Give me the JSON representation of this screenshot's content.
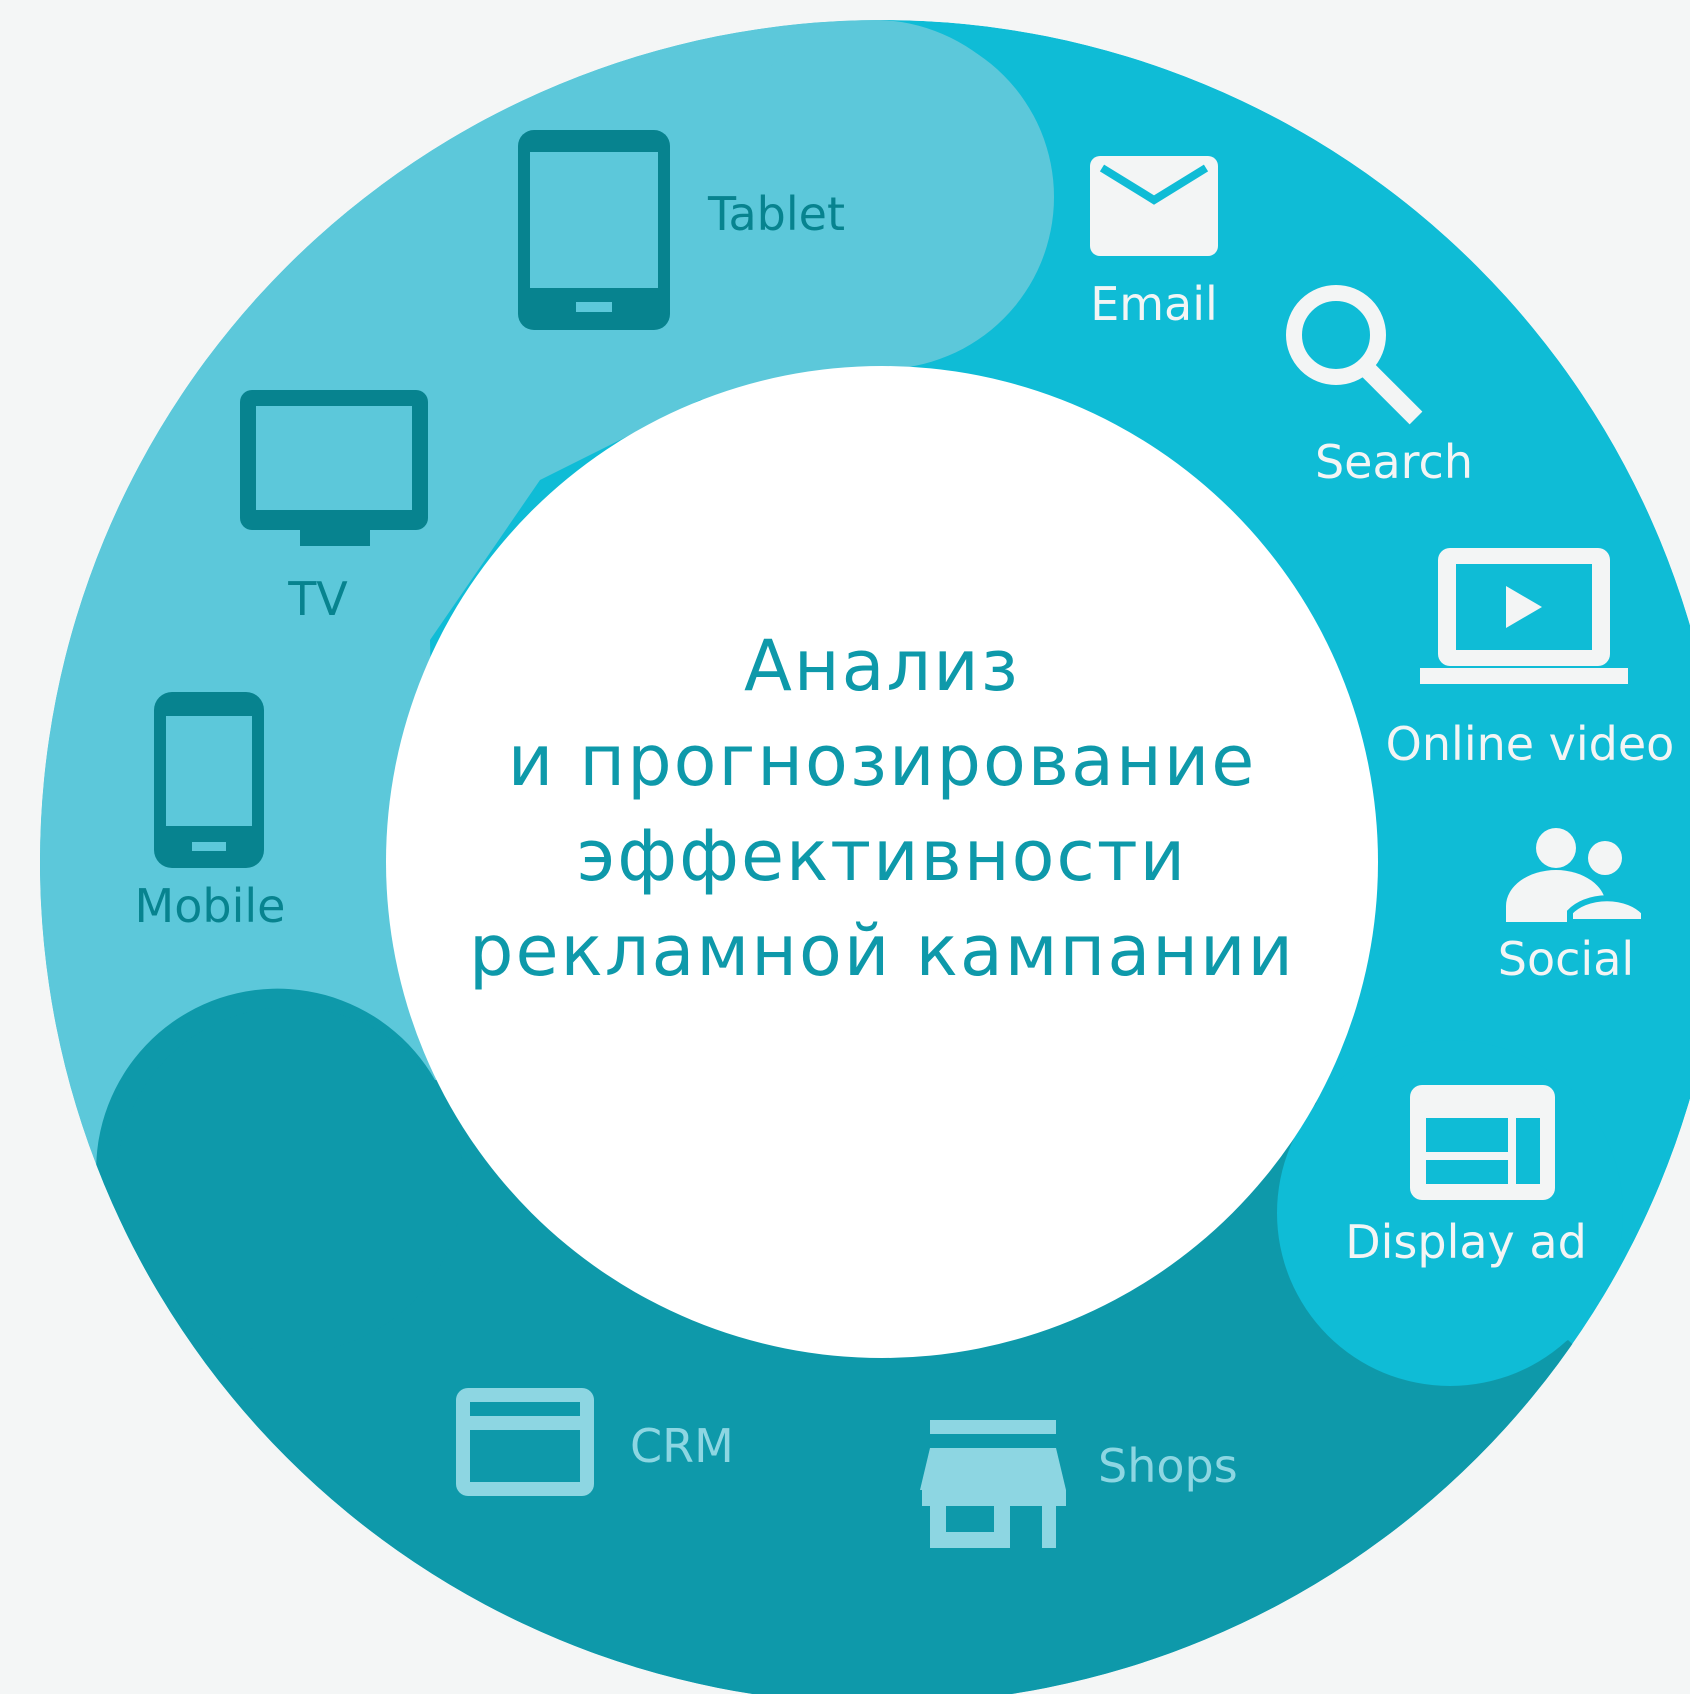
{
  "diagram": {
    "center_lines": [
      "Анализ",
      "и прогнозирование",
      "эффективности",
      "рекламной кампании"
    ],
    "segments": {
      "devices": {
        "color": "#5cc8da",
        "items": [
          {
            "label": "Tablet",
            "icon": "tablet-icon"
          },
          {
            "label": "TV",
            "icon": "tv-icon"
          },
          {
            "label": "Mobile",
            "icon": "mobile-icon"
          }
        ]
      },
      "online_channels": {
        "color": "#0fbcd6",
        "items": [
          {
            "label": "Email",
            "icon": "envelope-icon"
          },
          {
            "label": "Search",
            "icon": "magnifier-icon"
          },
          {
            "label": "Online video",
            "icon": "video-player-icon"
          },
          {
            "label": "Social",
            "icon": "people-icon"
          },
          {
            "label": "Display ad",
            "icon": "display-ad-icon"
          }
        ]
      },
      "offline_data": {
        "color": "#0e99aa",
        "items": [
          {
            "label": "CRM",
            "icon": "card-icon"
          },
          {
            "label": "Shops",
            "icon": "store-icon"
          }
        ]
      }
    },
    "colors": {
      "background": "#f4f6f6",
      "center_circle": "#ffffff",
      "center_text": "#0e99aa",
      "devices_foreground": "#07838f",
      "online_foreground": "#f3f5f5",
      "offline_foreground": "#8dd6e2"
    }
  }
}
